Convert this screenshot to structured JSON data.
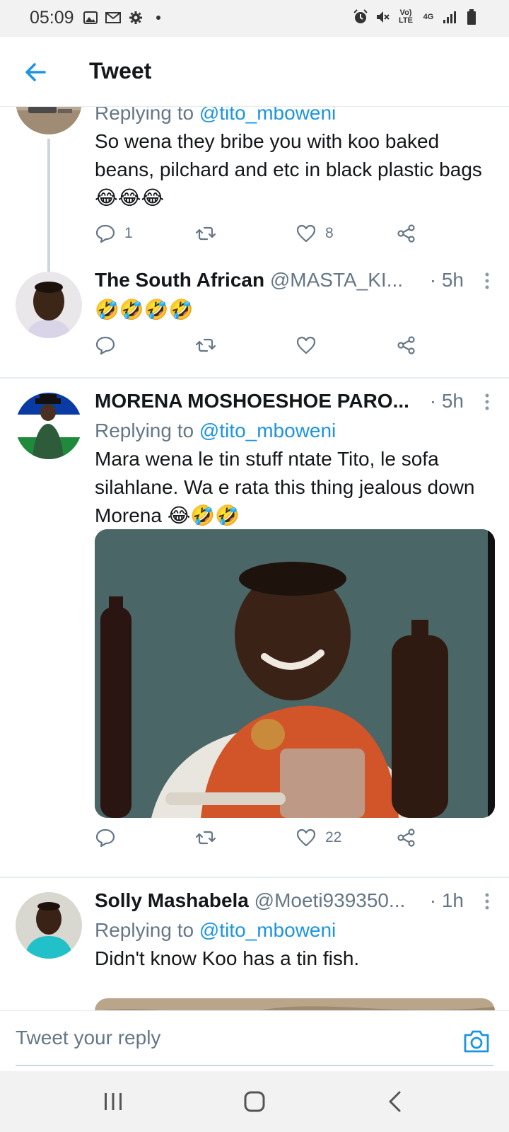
{
  "status_bar": {
    "time": "05:09",
    "volte": "Vo)\nLTE",
    "network": "4G"
  },
  "header": {
    "title": "Tweet"
  },
  "tweets": [
    {
      "id": "t1",
      "replying_to_prefix": "Replying to",
      "replying_to": "@tito_mboweni",
      "text": "So wena they bribe you with koo baked beans, pilchard and etc in black plastic bags",
      "emojis": "😂😂😂",
      "reply_count": "1",
      "retweet_count": "",
      "like_count": "8"
    },
    {
      "id": "t2",
      "name": "The South African",
      "handle": "@MASTA_KI...",
      "time": "· 5h",
      "emojis": "🤣🤣🤣🤣",
      "reply_count": "",
      "retweet_count": "",
      "like_count": ""
    },
    {
      "id": "t3",
      "name": "MORENA MOSHOESHOE PARO...",
      "handle": "",
      "time": "· 5h",
      "replying_to_prefix": "Replying to",
      "replying_to": "@tito_mboweni",
      "text": "Mara wena le tin stuff ntate Tito, le sofa silahlane. Wa e rata this thing jealous down Morena",
      "emojis": "😂🤣🤣",
      "reply_count": "",
      "retweet_count": "",
      "like_count": "22"
    },
    {
      "id": "t4",
      "name": "Solly Mashabela",
      "handle": "@Moeti939350...",
      "time": "· 1h",
      "replying_to_prefix": "Replying to",
      "replying_to": "@tito_mboweni",
      "text": "Didn't know Koo has a tin fish."
    }
  ],
  "reply_composer": {
    "placeholder": "Tweet your reply"
  },
  "colors": {
    "accent": "#1b95e0",
    "text_secondary": "#657786",
    "divider": "#e6ecf0",
    "system_bar": "#f2f2f2"
  },
  "icons": {
    "back": "arrow-left-icon",
    "reply": "speech-bubble-icon",
    "retweet": "retweet-icon",
    "like": "heart-icon",
    "share": "share-icon",
    "camera": "camera-icon"
  }
}
